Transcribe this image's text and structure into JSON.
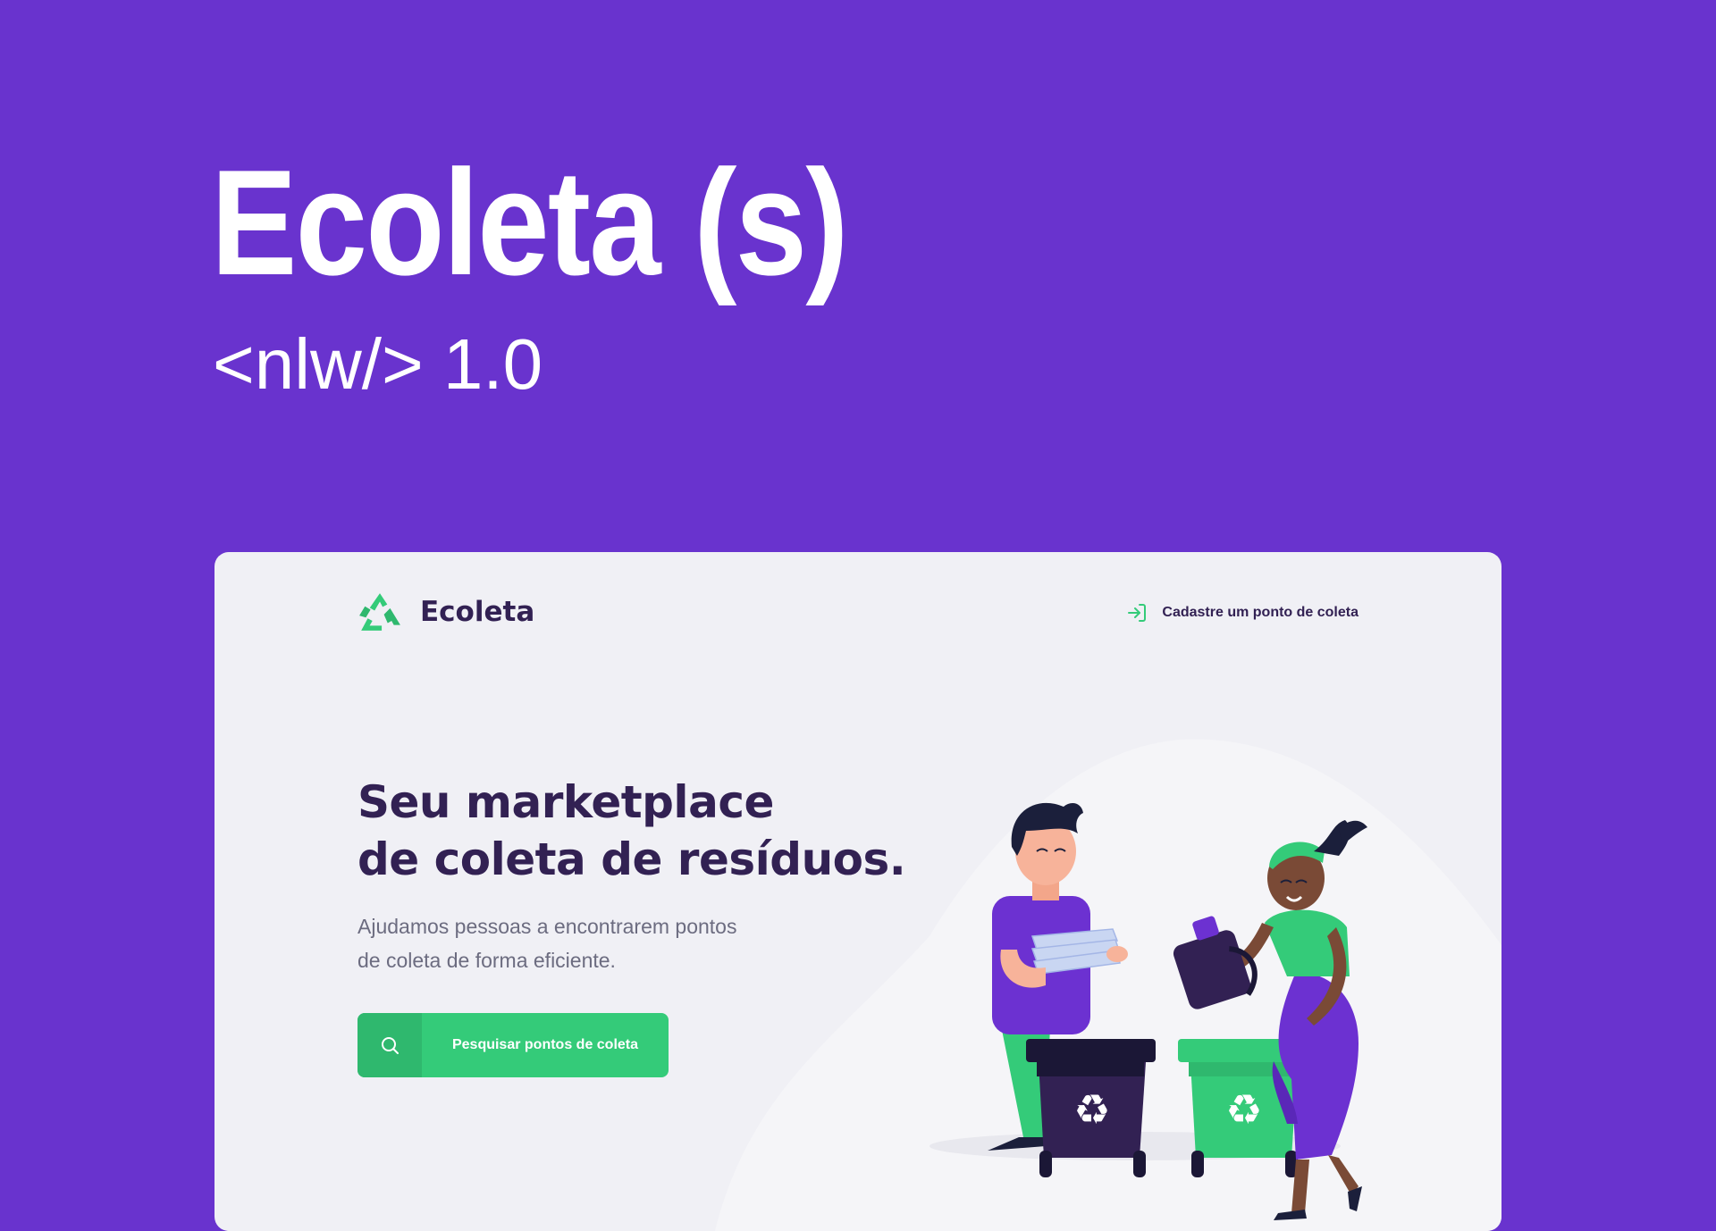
{
  "banner": {
    "title": "Ecoleta (s)",
    "subtitle": "<nlw/> 1.0"
  },
  "header": {
    "logo_text": "Ecoleta",
    "logo_icon": "recycle-icon",
    "link_label": "Cadastre um ponto de coleta",
    "link_icon": "log-in-icon"
  },
  "hero": {
    "headline_line1": "Seu marketplace",
    "headline_line2": "de coleta de resíduos.",
    "description_line1": "Ajudamos pessoas a encontrarem pontos",
    "description_line2": "de coleta de forma eficiente.",
    "cta_label": "Pesquisar pontos de coleta",
    "cta_icon": "search-icon"
  },
  "colors": {
    "background": "#6933CE",
    "card": "#F0F0F5",
    "primary": "#34CB79",
    "title": "#322153",
    "text": "#6C6C80"
  }
}
